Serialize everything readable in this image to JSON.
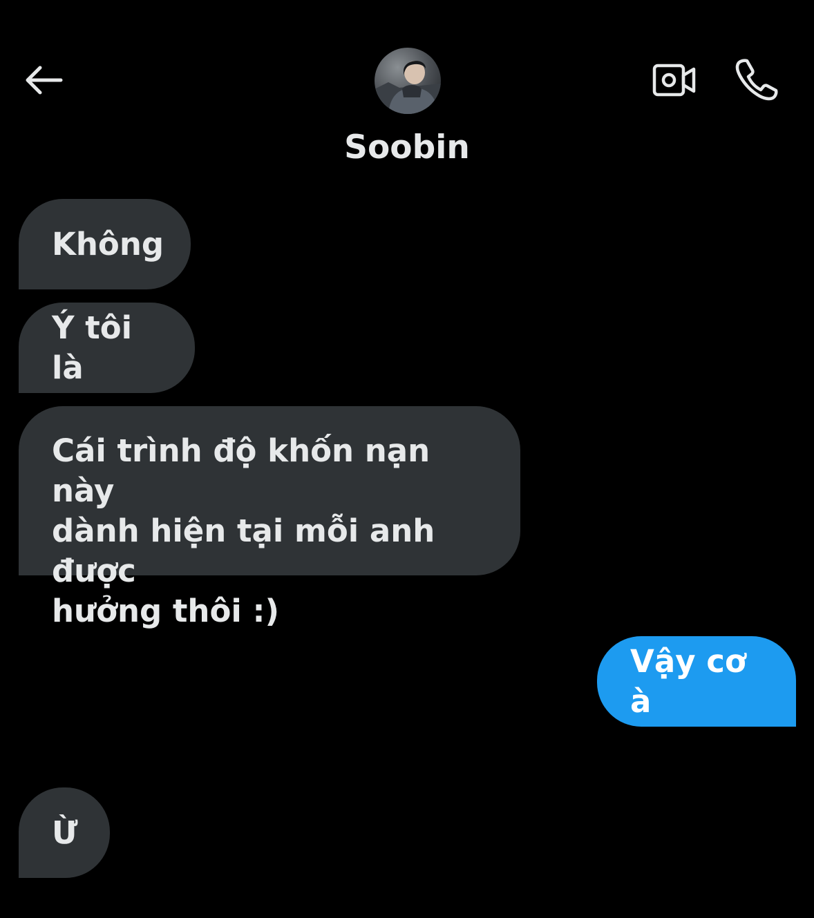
{
  "header": {
    "contact_name": "Soobin",
    "back_icon": "arrow-left-icon",
    "video_icon": "video-camera-icon",
    "call_icon": "phone-icon"
  },
  "messages": [
    {
      "direction": "incoming",
      "lines": [
        "Không"
      ]
    },
    {
      "direction": "incoming",
      "lines": [
        "Ý tôi là"
      ]
    },
    {
      "direction": "incoming",
      "lines": [
        "Cái trình độ khốn nạn này",
        "dành hiện tại mỗi anh được",
        "hưởng thôi :)"
      ]
    },
    {
      "direction": "outgoing",
      "lines": [
        "Vậy cơ à"
      ]
    },
    {
      "direction": "incoming",
      "lines": [
        "Ừ"
      ]
    }
  ],
  "colors": {
    "background": "#000000",
    "incoming_bubble": "#2f3336",
    "outgoing_bubble": "#1d9bf0",
    "text_primary": "#e7e9ea"
  }
}
